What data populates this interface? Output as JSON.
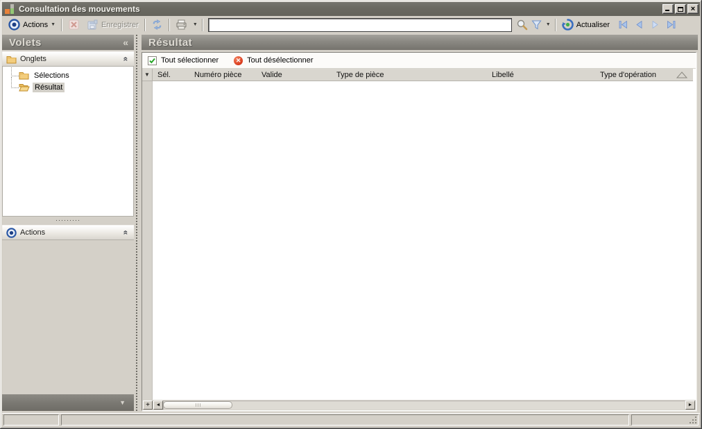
{
  "window": {
    "title": "Consultation des mouvements"
  },
  "toolbar": {
    "actions_label": "Actions",
    "save_label": "Enregistrer",
    "search_value": "",
    "refresh_label": "Actualiser"
  },
  "sidebar": {
    "title": "Volets",
    "onglets_section": {
      "label": "Onglets",
      "items": [
        {
          "label": "Sélections",
          "selected": false
        },
        {
          "label": "Résultat",
          "selected": true
        }
      ]
    },
    "actions_section": {
      "label": "Actions"
    }
  },
  "main": {
    "title": "Résultat",
    "select_toolbar": {
      "select_all_label": "Tout sélectionner",
      "deselect_all_label": "Tout désélectionner"
    },
    "table": {
      "columns": [
        "Sél.",
        "Numéro pièce",
        "Valide",
        "Type de pièce",
        "Libellé",
        "Type d'opération"
      ],
      "rows": [],
      "sort_column": "Type d'opération",
      "sort_direction": "asc"
    }
  },
  "icons": {
    "collapse_panel": "«",
    "collapse_section": "«",
    "dropdown_arrow": "▼",
    "row_selector": "▼",
    "sort_asc": "",
    "add_row": "+",
    "scroll_left": "◄",
    "scroll_right": "►",
    "overflow_down": "▼",
    "check": "",
    "deselect_x": "✕",
    "close": "×",
    "splitter_dots": "·········"
  },
  "colors": {
    "titlebar": "#6b6a62",
    "window_bg": "#d4d0c8",
    "panel_header_text": "#dcd9d1",
    "accent_blue": "#2a57a5",
    "nav_arrow_blue": "#a9c4ea",
    "alert_red": "#d93a1c",
    "check_green": "#27a527",
    "folder_yellow": "#f3cd7d",
    "selection_gray": "#d2cfc8"
  }
}
